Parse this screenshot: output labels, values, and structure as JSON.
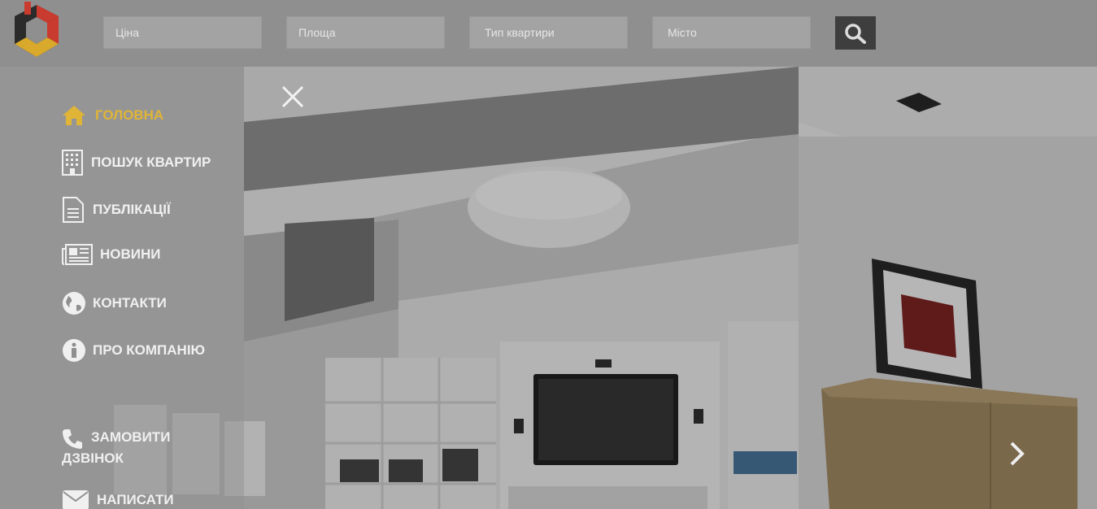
{
  "search": {
    "price_placeholder": "Ціна",
    "area_placeholder": "Площа",
    "type_placeholder": "Тип квартири",
    "city_placeholder": "Місто"
  },
  "menu": {
    "items": [
      {
        "label": "ГОЛОВНА",
        "icon": "home-icon",
        "active": true
      },
      {
        "label": "ПОШУК КВАРТИР",
        "icon": "building-icon"
      },
      {
        "label": "ПУБЛІКАЦІЇ",
        "icon": "document-icon"
      },
      {
        "label": "НОВИНИ",
        "icon": "newspaper-icon"
      },
      {
        "label": "КОНТАКТИ",
        "icon": "globe-icon"
      },
      {
        "label": "ПРО КОМПАНІЮ",
        "icon": "info-icon"
      },
      {
        "label": "ЗАМОВИТИ ДЗВІНОК",
        "icon": "phone-icon"
      },
      {
        "label": "НАПИСАТИ",
        "icon": "envelope-icon"
      }
    ]
  },
  "colors": {
    "accent": "#e0b537",
    "topbar": "#8f8f8f",
    "search_button": "#3e3e3e"
  }
}
